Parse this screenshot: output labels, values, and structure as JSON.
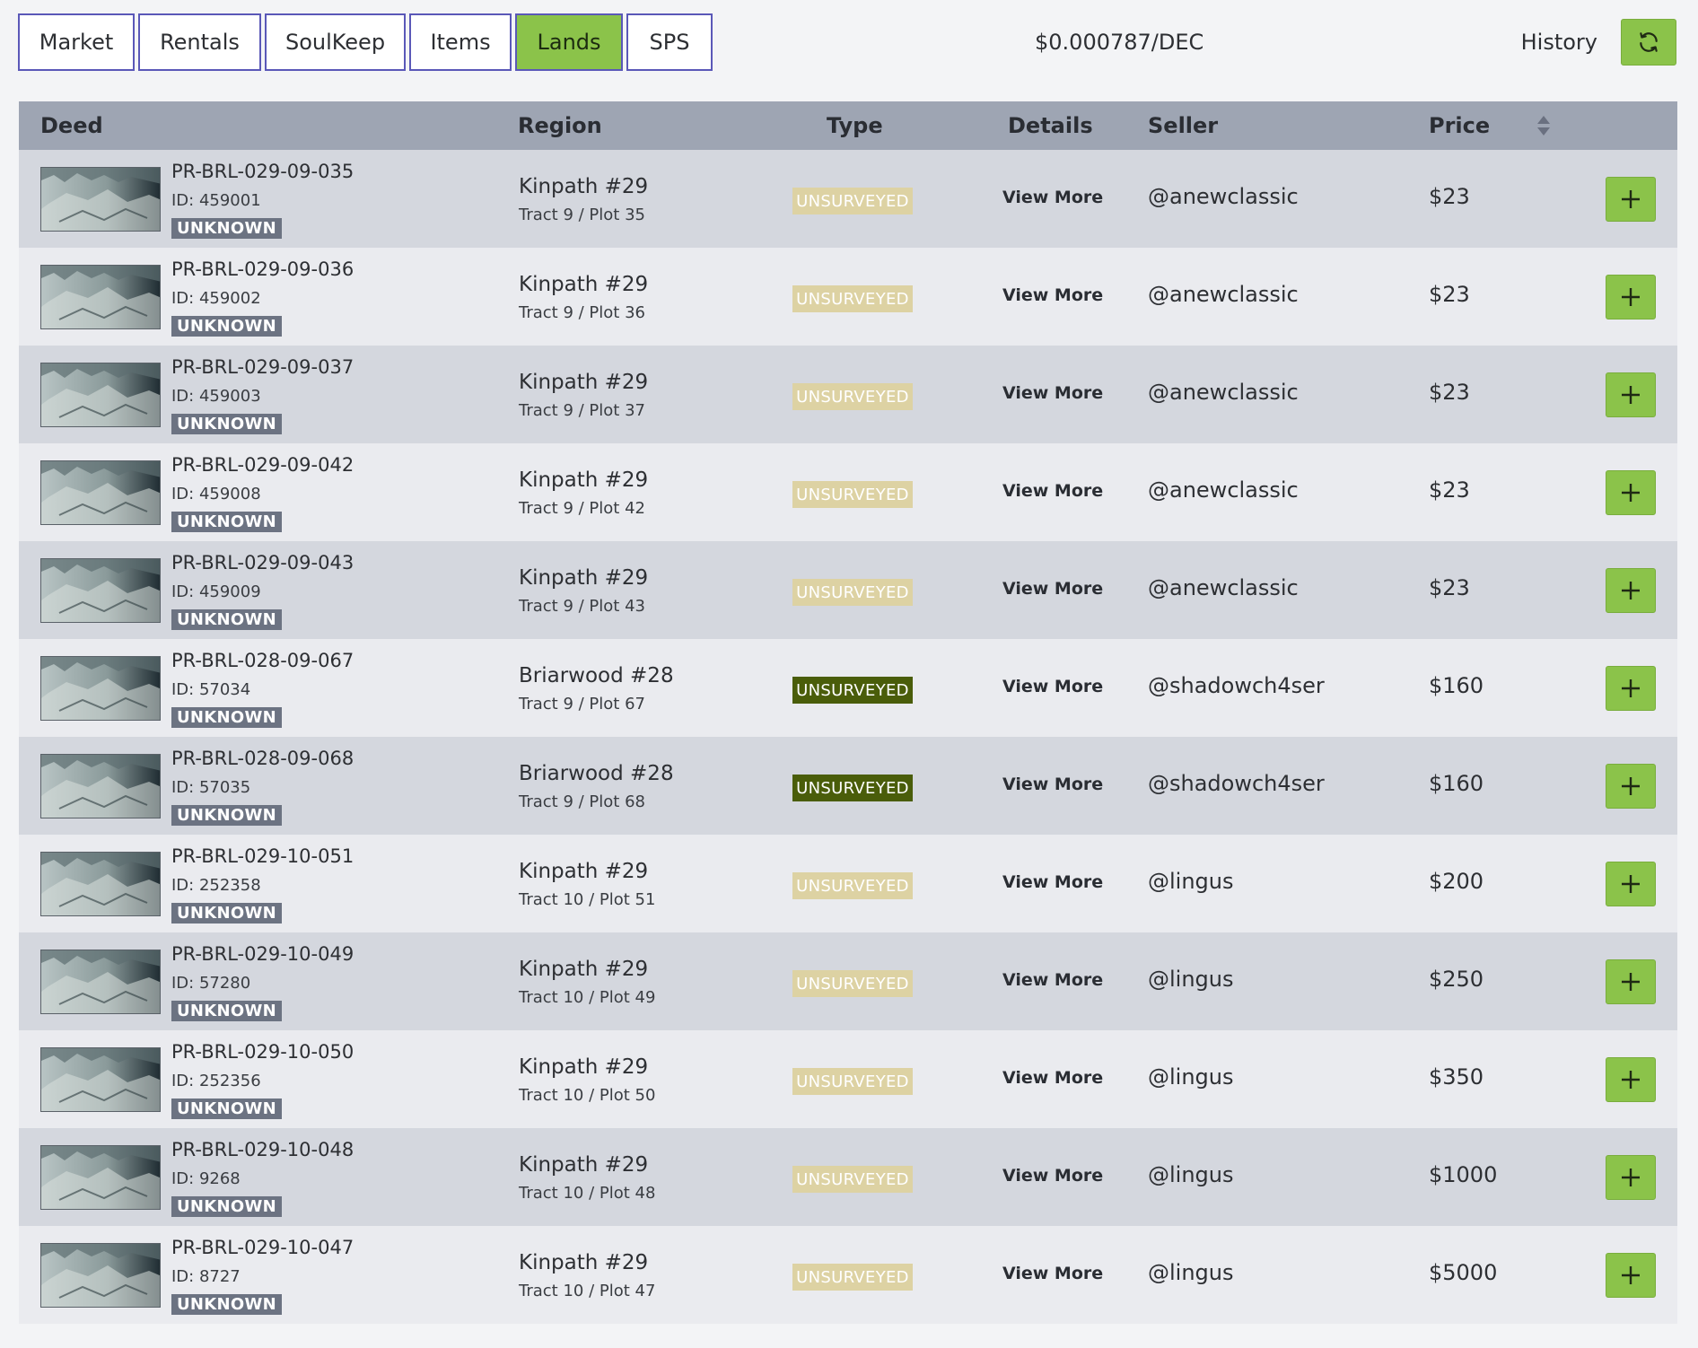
{
  "tabs": [
    {
      "label": "Market",
      "active": false
    },
    {
      "label": "Rentals",
      "active": false
    },
    {
      "label": "SoulKeep",
      "active": false
    },
    {
      "label": "Items",
      "active": false
    },
    {
      "label": "Lands",
      "active": true
    },
    {
      "label": "SPS",
      "active": false
    }
  ],
  "dec_price": "$0.000787/DEC",
  "history_label": "History",
  "refresh_icon": "refresh-icon",
  "colors": {
    "accent_green": "#8bc34a",
    "tab_border": "#5a58b8",
    "header_bg": "#9ea5b3",
    "unsurveyed_light": "#ddd2a3",
    "unsurveyed_dark": "#4a5d0a"
  },
  "table": {
    "headers": {
      "deed": "Deed",
      "region": "Region",
      "type": "Type",
      "details": "Details",
      "seller": "Seller",
      "price": "Price"
    },
    "rows": [
      {
        "deed": "PR-BRL-029-09-035",
        "id": "ID: 459001",
        "badge": "UNKNOWN",
        "region": "Kinpath #29",
        "plot": "Tract 9 / Plot 35",
        "type": "UNSURVEYED",
        "type_style": "light",
        "details": "View More",
        "seller": "@anewclassic",
        "price": "$23"
      },
      {
        "deed": "PR-BRL-029-09-036",
        "id": "ID: 459002",
        "badge": "UNKNOWN",
        "region": "Kinpath #29",
        "plot": "Tract 9 / Plot 36",
        "type": "UNSURVEYED",
        "type_style": "light",
        "details": "View More",
        "seller": "@anewclassic",
        "price": "$23"
      },
      {
        "deed": "PR-BRL-029-09-037",
        "id": "ID: 459003",
        "badge": "UNKNOWN",
        "region": "Kinpath #29",
        "plot": "Tract 9 / Plot 37",
        "type": "UNSURVEYED",
        "type_style": "light",
        "details": "View More",
        "seller": "@anewclassic",
        "price": "$23"
      },
      {
        "deed": "PR-BRL-029-09-042",
        "id": "ID: 459008",
        "badge": "UNKNOWN",
        "region": "Kinpath #29",
        "plot": "Tract 9 / Plot 42",
        "type": "UNSURVEYED",
        "type_style": "light",
        "details": "View More",
        "seller": "@anewclassic",
        "price": "$23"
      },
      {
        "deed": "PR-BRL-029-09-043",
        "id": "ID: 459009",
        "badge": "UNKNOWN",
        "region": "Kinpath #29",
        "plot": "Tract 9 / Plot 43",
        "type": "UNSURVEYED",
        "type_style": "light",
        "details": "View More",
        "seller": "@anewclassic",
        "price": "$23"
      },
      {
        "deed": "PR-BRL-028-09-067",
        "id": "ID: 57034",
        "badge": "UNKNOWN",
        "region": "Briarwood #28",
        "plot": "Tract 9 / Plot 67",
        "type": "UNSURVEYED",
        "type_style": "dark",
        "details": "View More",
        "seller": "@shadowch4ser",
        "price": "$160"
      },
      {
        "deed": "PR-BRL-028-09-068",
        "id": "ID: 57035",
        "badge": "UNKNOWN",
        "region": "Briarwood #28",
        "plot": "Tract 9 / Plot 68",
        "type": "UNSURVEYED",
        "type_style": "dark",
        "details": "View More",
        "seller": "@shadowch4ser",
        "price": "$160"
      },
      {
        "deed": "PR-BRL-029-10-051",
        "id": "ID: 252358",
        "badge": "UNKNOWN",
        "region": "Kinpath #29",
        "plot": "Tract 10 / Plot 51",
        "type": "UNSURVEYED",
        "type_style": "light",
        "details": "View More",
        "seller": "@lingus",
        "price": "$200"
      },
      {
        "deed": "PR-BRL-029-10-049",
        "id": "ID: 57280",
        "badge": "UNKNOWN",
        "region": "Kinpath #29",
        "plot": "Tract 10 / Plot 49",
        "type": "UNSURVEYED",
        "type_style": "light",
        "details": "View More",
        "seller": "@lingus",
        "price": "$250"
      },
      {
        "deed": "PR-BRL-029-10-050",
        "id": "ID: 252356",
        "badge": "UNKNOWN",
        "region": "Kinpath #29",
        "plot": "Tract 10 / Plot 50",
        "type": "UNSURVEYED",
        "type_style": "light",
        "details": "View More",
        "seller": "@lingus",
        "price": "$350"
      },
      {
        "deed": "PR-BRL-029-10-048",
        "id": "ID: 9268",
        "badge": "UNKNOWN",
        "region": "Kinpath #29",
        "plot": "Tract 10 / Plot 48",
        "type": "UNSURVEYED",
        "type_style": "light",
        "details": "View More",
        "seller": "@lingus",
        "price": "$1000"
      },
      {
        "deed": "PR-BRL-029-10-047",
        "id": "ID: 8727",
        "badge": "UNKNOWN",
        "region": "Kinpath #29",
        "plot": "Tract 10 / Plot 47",
        "type": "UNSURVEYED",
        "type_style": "light",
        "details": "View More",
        "seller": "@lingus",
        "price": "$5000"
      }
    ]
  }
}
